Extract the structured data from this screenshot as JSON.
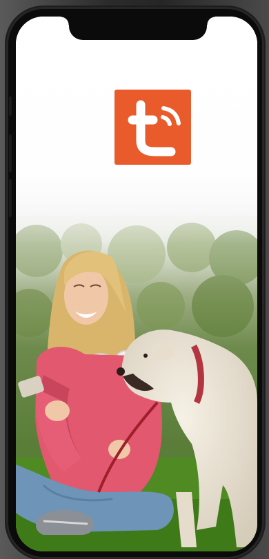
{
  "app": {
    "logo_icon": "tuya-smart-logo-icon",
    "logo_color": "#e95b2b"
  },
  "device": {
    "frame": "smartphone"
  }
}
